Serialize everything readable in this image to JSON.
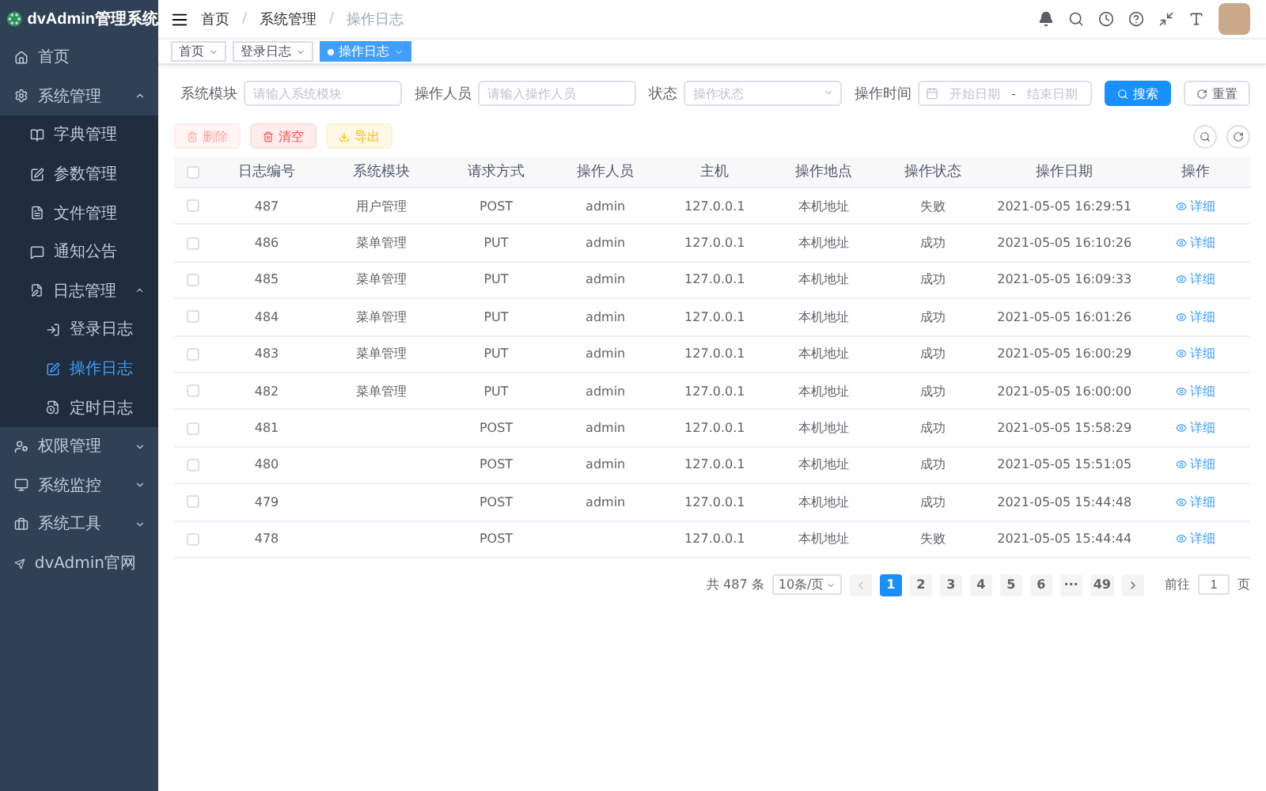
{
  "sidebar": {
    "title": "dvAdmin管理系统",
    "items": [
      {
        "label": "首页",
        "kind": "link",
        "selected": false
      },
      {
        "label": "系统管理",
        "kind": "group",
        "expanded": true,
        "selected": false,
        "children": [
          {
            "label": "字典管理",
            "kind": "link",
            "selected": false
          },
          {
            "label": "参数管理",
            "kind": "link",
            "selected": false
          },
          {
            "label": "文件管理",
            "kind": "link",
            "selected": false
          },
          {
            "label": "通知公告",
            "kind": "link",
            "selected": false
          },
          {
            "label": "日志管理",
            "kind": "group",
            "expanded": true,
            "selected": false,
            "children": [
              {
                "label": "登录日志",
                "kind": "link",
                "selected": false
              },
              {
                "label": "操作日志",
                "kind": "link",
                "selected": true
              },
              {
                "label": "定时日志",
                "kind": "link",
                "selected": false
              }
            ]
          }
        ]
      },
      {
        "label": "权限管理",
        "kind": "group",
        "expanded": false,
        "selected": false
      },
      {
        "label": "系统监控",
        "kind": "group",
        "expanded": false,
        "selected": false
      },
      {
        "label": "系统工具",
        "kind": "group",
        "expanded": false,
        "selected": false
      },
      {
        "label": "dvAdmin官网",
        "kind": "link",
        "selected": false
      }
    ]
  },
  "breadcrumb": [
    "首页",
    "系统管理",
    "操作日志"
  ],
  "breadcrumb_separator": "/",
  "tags": [
    {
      "label": "首页",
      "selected": false
    },
    {
      "label": "登录日志",
      "selected": false
    },
    {
      "label": "操作日志",
      "selected": true
    }
  ],
  "search": {
    "fields": [
      {
        "label": "系统模块",
        "kind": "input",
        "placeholder": "请输入系统模块"
      },
      {
        "label": "操作人员",
        "kind": "input",
        "placeholder": "请输入操作人员"
      },
      {
        "label": "状态",
        "kind": "select",
        "placeholder": "操作状态"
      },
      {
        "label": "操作时间",
        "kind": "daterange",
        "start_placeholder": "开始日期",
        "separator": "-",
        "end_placeholder": "结束日期"
      }
    ],
    "buttons": [
      {
        "label": "搜索",
        "kind": "primary"
      },
      {
        "label": "重置",
        "kind": "default"
      }
    ]
  },
  "actions": [
    {
      "label": "删除",
      "kind": "danger",
      "disabled": true
    },
    {
      "label": "清空",
      "kind": "danger",
      "disabled": false
    },
    {
      "label": "导出",
      "kind": "warning",
      "disabled": false
    }
  ],
  "table": {
    "select_all_checked": false,
    "columns": [
      "日志编号",
      "系统模块",
      "请求方式",
      "操作人员",
      "主机",
      "操作地点",
      "操作状态",
      "操作日期",
      "操作"
    ],
    "rows": [
      {
        "checked": false,
        "cells": [
          "487",
          "用户管理",
          "POST",
          "admin",
          "127.0.0.1",
          "本机地址",
          "失败",
          "2021-05-05 16:29:51"
        ],
        "action": "详细"
      },
      {
        "checked": false,
        "cells": [
          "486",
          "菜单管理",
          "PUT",
          "admin",
          "127.0.0.1",
          "本机地址",
          "成功",
          "2021-05-05 16:10:26"
        ],
        "action": "详细"
      },
      {
        "checked": false,
        "cells": [
          "485",
          "菜单管理",
          "PUT",
          "admin",
          "127.0.0.1",
          "本机地址",
          "成功",
          "2021-05-05 16:09:33"
        ],
        "action": "详细"
      },
      {
        "checked": false,
        "cells": [
          "484",
          "菜单管理",
          "PUT",
          "admin",
          "127.0.0.1",
          "本机地址",
          "成功",
          "2021-05-05 16:01:26"
        ],
        "action": "详细"
      },
      {
        "checked": false,
        "cells": [
          "483",
          "菜单管理",
          "PUT",
          "admin",
          "127.0.0.1",
          "本机地址",
          "成功",
          "2021-05-05 16:00:29"
        ],
        "action": "详细"
      },
      {
        "checked": false,
        "cells": [
          "482",
          "菜单管理",
          "PUT",
          "admin",
          "127.0.0.1",
          "本机地址",
          "成功",
          "2021-05-05 16:00:00"
        ],
        "action": "详细"
      },
      {
        "checked": false,
        "cells": [
          "481",
          "",
          "POST",
          "admin",
          "127.0.0.1",
          "本机地址",
          "成功",
          "2021-05-05 15:58:29"
        ],
        "action": "详细"
      },
      {
        "checked": false,
        "cells": [
          "480",
          "",
          "POST",
          "admin",
          "127.0.0.1",
          "本机地址",
          "成功",
          "2021-05-05 15:51:05"
        ],
        "action": "详细"
      },
      {
        "checked": false,
        "cells": [
          "479",
          "",
          "POST",
          "admin",
          "127.0.0.1",
          "本机地址",
          "成功",
          "2021-05-05 15:44:48"
        ],
        "action": "详细"
      },
      {
        "checked": false,
        "cells": [
          "478",
          "",
          "POST",
          "",
          "127.0.0.1",
          "本机地址",
          "失败",
          "2021-05-05 15:44:44"
        ],
        "action": "详细"
      }
    ]
  },
  "pagination": {
    "total": "共 487 条",
    "page_size": "10条/页",
    "pages": [
      {
        "label": "1",
        "selected": true
      },
      {
        "label": "2",
        "selected": false
      },
      {
        "label": "3",
        "selected": false
      },
      {
        "label": "4",
        "selected": false
      },
      {
        "label": "5",
        "selected": false
      },
      {
        "label": "6",
        "selected": false
      },
      {
        "label": "···",
        "selected": false
      },
      {
        "label": "49",
        "selected": false
      }
    ],
    "prev_disabled": true,
    "goto_label": "前往",
    "goto_value": "1",
    "page_unit": "页"
  }
}
